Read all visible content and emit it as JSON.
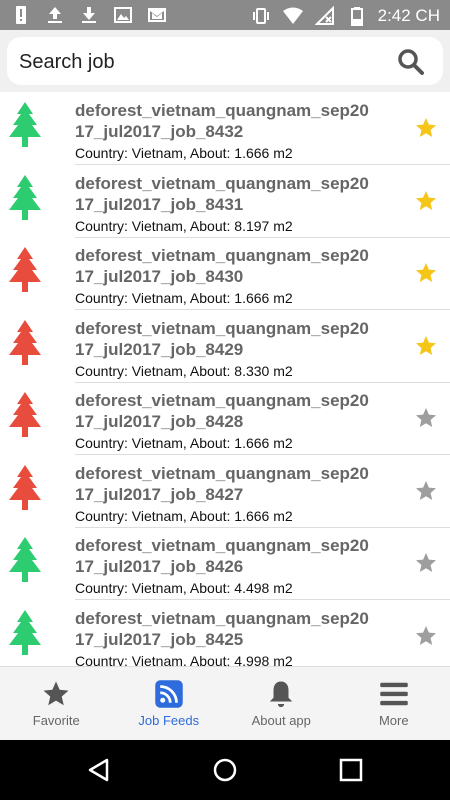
{
  "status_bar": {
    "time": "2:42 CH",
    "left_icons": [
      "alert-icon",
      "upload-icon",
      "download-icon",
      "image-icon",
      "mail-icon"
    ],
    "right_icons": [
      "vibrate-icon",
      "wifi-icon",
      "no-signal-icon",
      "battery-icon"
    ]
  },
  "search": {
    "placeholder": "Search job",
    "value": ""
  },
  "colors": {
    "tree_green": "#2ecc71",
    "tree_red": "#e74c3c",
    "star_gold": "#f5c518",
    "star_gray": "#9e9e9e",
    "accent": "#2e6bdc"
  },
  "jobs": [
    {
      "title": "deforest_vietnam_quangnam_sep2017_jul2017_job_8432",
      "meta": "Country: Vietnam, About: 1.666 m2",
      "tree": "green",
      "starred": true
    },
    {
      "title": "deforest_vietnam_quangnam_sep2017_jul2017_job_8431",
      "meta": "Country: Vietnam, About: 8.197 m2",
      "tree": "green",
      "starred": true
    },
    {
      "title": "deforest_vietnam_quangnam_sep2017_jul2017_job_8430",
      "meta": "Country: Vietnam, About: 1.666 m2",
      "tree": "red",
      "starred": true
    },
    {
      "title": "deforest_vietnam_quangnam_sep2017_jul2017_job_8429",
      "meta": "Country: Vietnam, About: 8.330 m2",
      "tree": "red",
      "starred": true
    },
    {
      "title": "deforest_vietnam_quangnam_sep2017_jul2017_job_8428",
      "meta": "Country: Vietnam, About: 1.666 m2",
      "tree": "red",
      "starred": false
    },
    {
      "title": "deforest_vietnam_quangnam_sep2017_jul2017_job_8427",
      "meta": "Country: Vietnam, About: 1.666 m2",
      "tree": "red",
      "starred": false
    },
    {
      "title": "deforest_vietnam_quangnam_sep2017_jul2017_job_8426",
      "meta": "Country: Vietnam, About: 4.498 m2",
      "tree": "green",
      "starred": false
    },
    {
      "title": "deforest_vietnam_quangnam_sep2017_jul2017_job_8425",
      "meta": "Country: Vietnam, About: 4.998 m2",
      "tree": "green",
      "starred": false
    }
  ],
  "tabs": [
    {
      "label": "Favorite",
      "icon": "star-icon",
      "active": false
    },
    {
      "label": "Job Feeds",
      "icon": "rss-icon",
      "active": true
    },
    {
      "label": "About app",
      "icon": "bell-icon",
      "active": false
    },
    {
      "label": "More",
      "icon": "menu-icon",
      "active": false
    }
  ],
  "nav": [
    "back-icon",
    "home-icon",
    "recents-icon"
  ]
}
